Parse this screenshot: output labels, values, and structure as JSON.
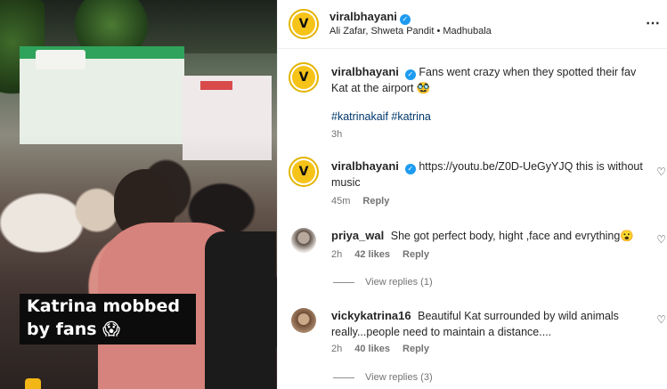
{
  "media": {
    "caption_line1": "Katrina mobbed",
    "caption_line2": "by fans 😱"
  },
  "header": {
    "username": "viralbhayani",
    "subtitle": "Ali Zafar, Shweta Pandit • Madhubala",
    "more_icon": "⋯"
  },
  "post": {
    "username": "viralbhayani",
    "text": "Fans went crazy when they spotted their fav Kat at the airport 🥸",
    "hashtags": "#katrinakaif #katrina",
    "time": "3h"
  },
  "comments": [
    {
      "username": "viralbhayani",
      "text": "https://youtu.be/Z0D-UeGyYJQ this is without music",
      "time": "45m",
      "reply": "Reply"
    },
    {
      "username": "priya_wal",
      "text": "She got perfect body, hight ,face and evrything😮",
      "time": "2h",
      "likes": "42 likes",
      "reply": "Reply",
      "view_replies": "View replies (1)"
    },
    {
      "username": "vickykatrina16",
      "text": "Beautiful Kat surrounded by wild animals really...people need to maintain a distance....",
      "time": "2h",
      "likes": "40 likes",
      "reply": "Reply",
      "view_replies": "View replies (3)"
    }
  ],
  "icons": {
    "verified": "✓",
    "heart": "♡",
    "logo_letter": "V"
  }
}
